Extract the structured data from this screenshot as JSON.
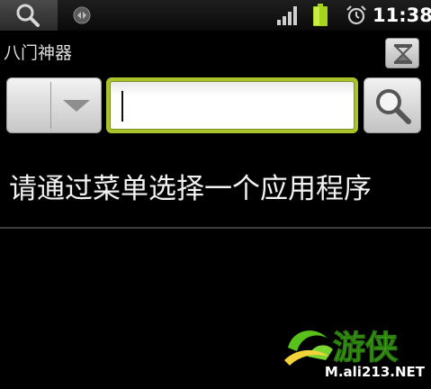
{
  "status_bar": {
    "time": "11:38",
    "icons": [
      "search-icon",
      "notification-icon",
      "signal-icon",
      "battery-icon",
      "alarm-icon"
    ],
    "battery_color": "#a6d31c"
  },
  "app": {
    "title": "八门神器"
  },
  "search": {
    "value": "",
    "accent_color": "#a9c42a"
  },
  "content": {
    "hint": "请通过菜单选择一个应用程序"
  },
  "watermark": {
    "logo_text": "游侠",
    "site": "M.ali213.NET"
  }
}
